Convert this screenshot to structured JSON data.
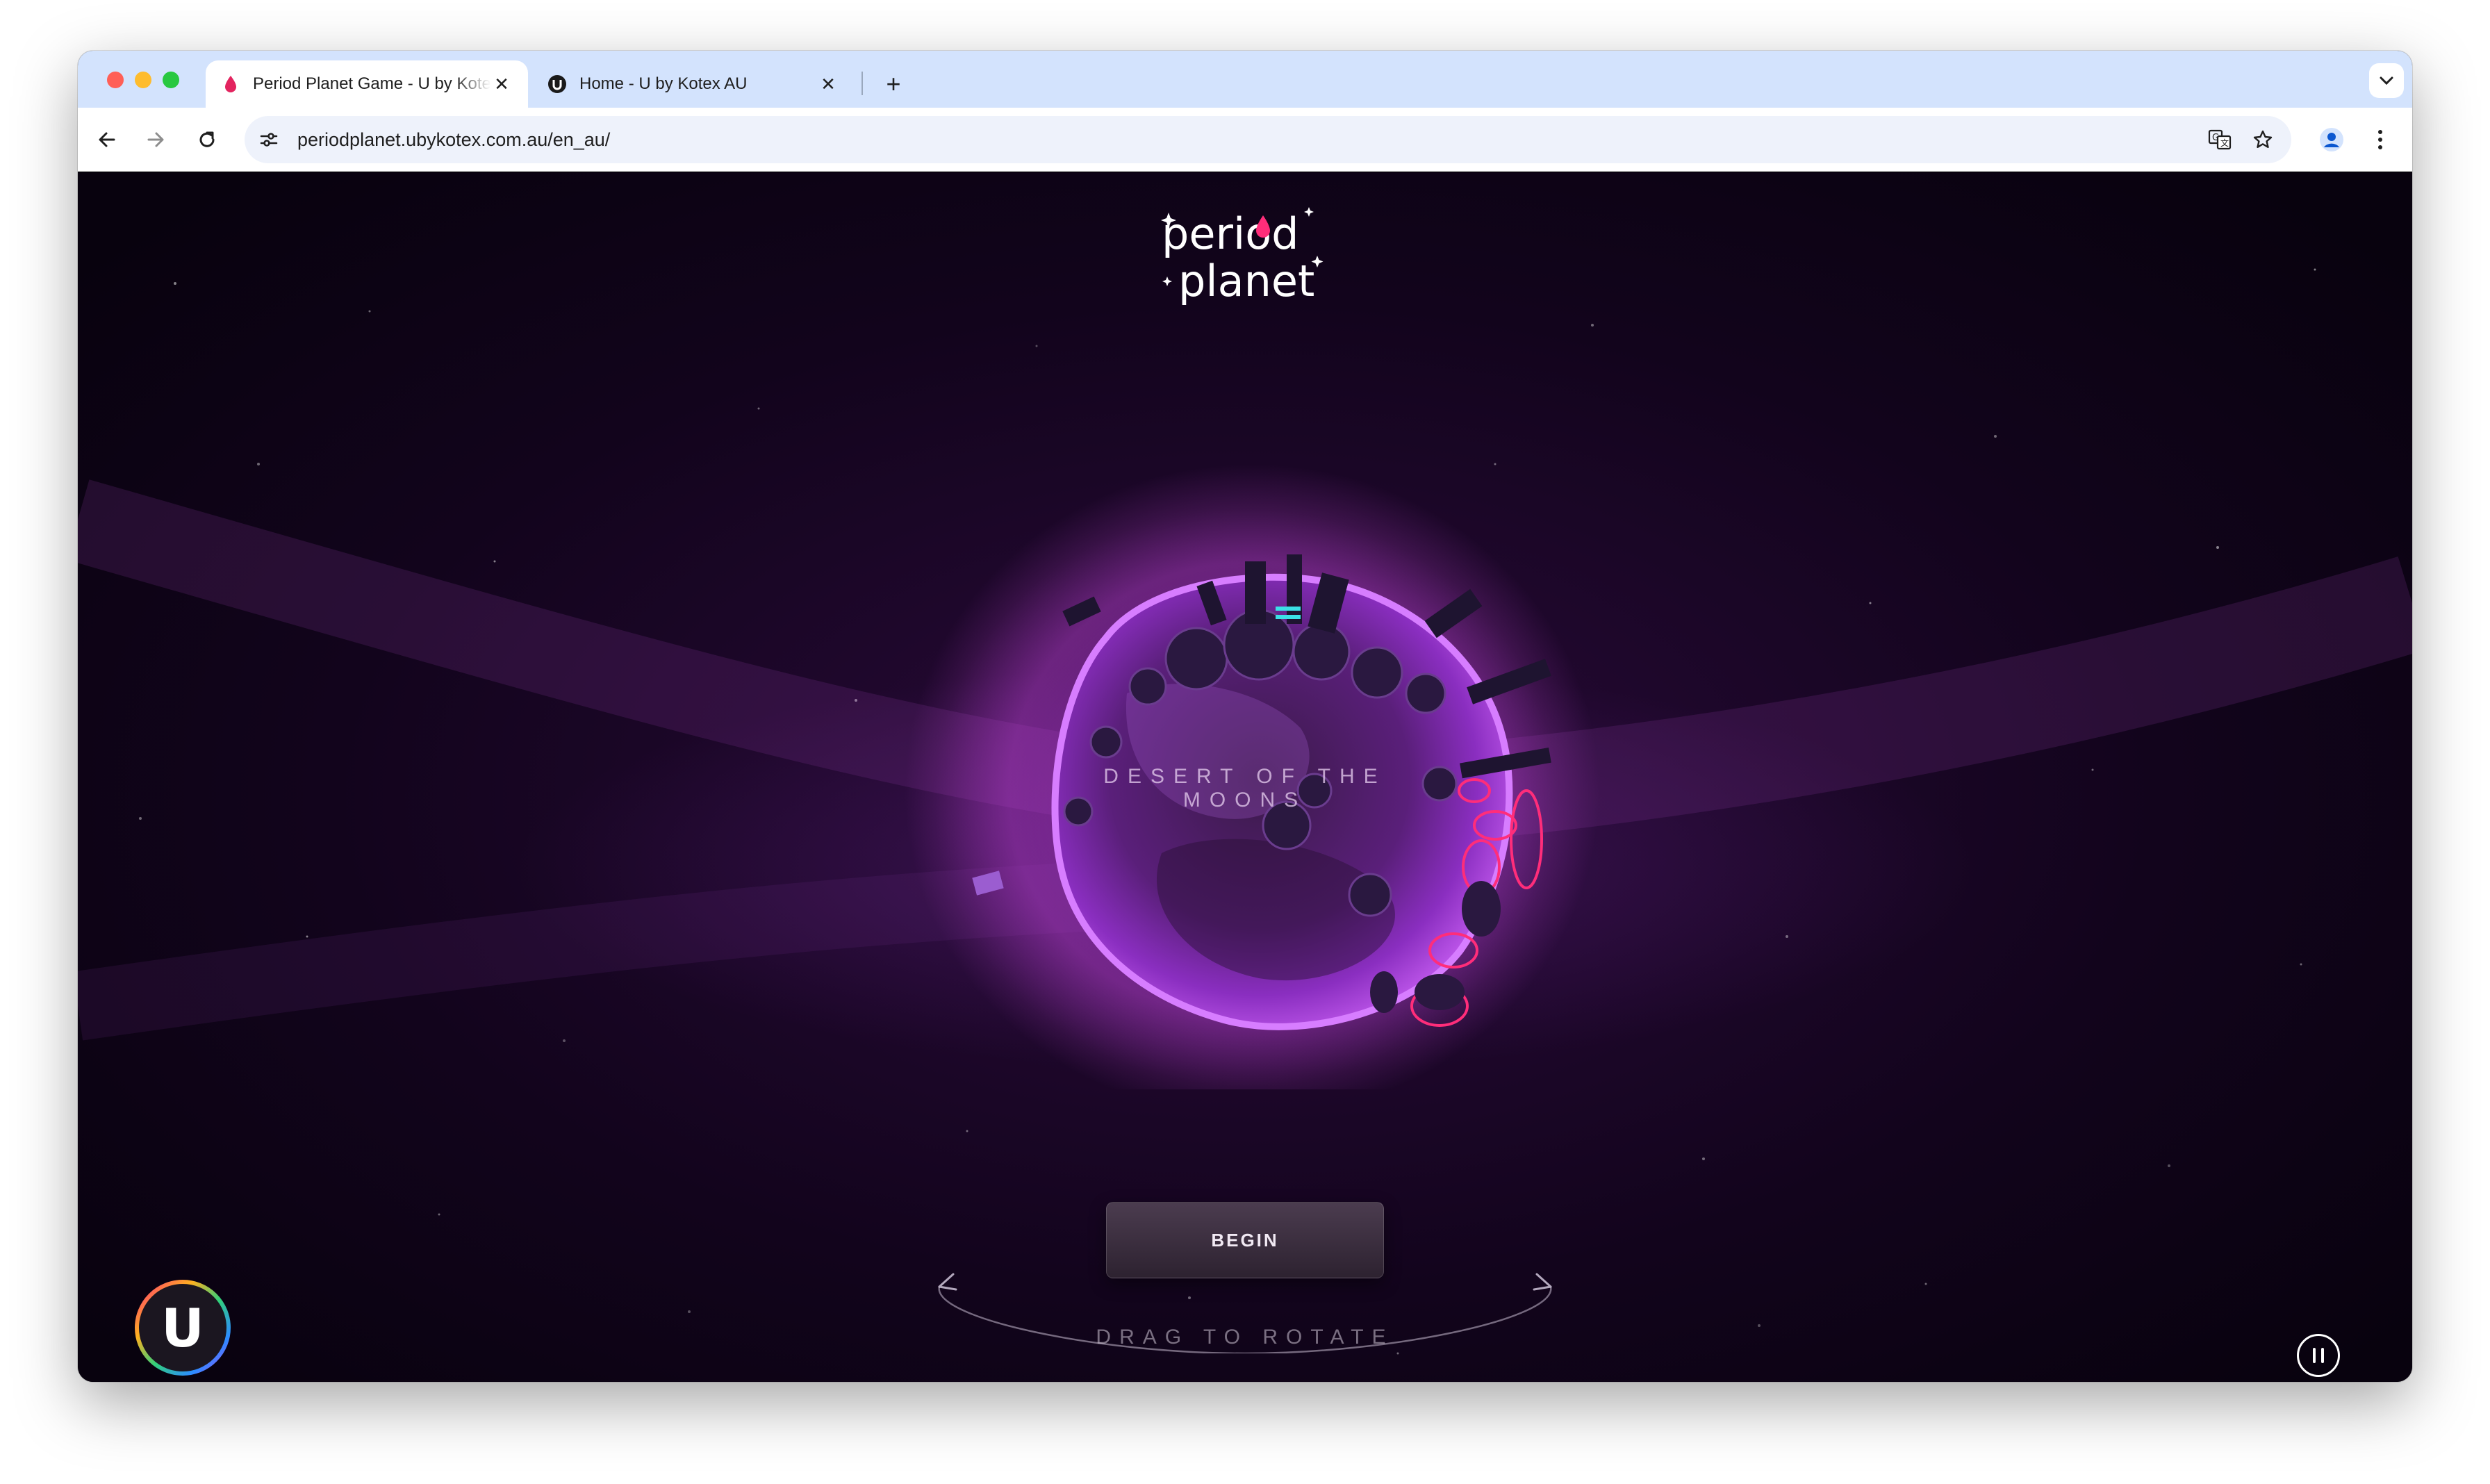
{
  "browser": {
    "tabs": [
      {
        "title": "Period Planet Game - U by Kotex",
        "active": true,
        "favicon": "droplet-icon"
      },
      {
        "title": "Home - U by Kotex AU",
        "active": false,
        "favicon": "u-logo-icon"
      }
    ],
    "new_tab_symbol": "+",
    "close_symbol": "✕",
    "url": "periodplanet.ubykotex.com.au/en_au/"
  },
  "page": {
    "logo": {
      "line1": "period",
      "line2": "planet"
    },
    "planet_label": "DESERT OF THE MOONS",
    "begin_label": "BEGIN",
    "drag_hint": "DRAG TO ROTATE",
    "brand_badge_letter": "U",
    "audio_control": "pause-icon"
  },
  "colors": {
    "tabstrip": "#d3e3fd",
    "background_deep": "#12041c",
    "planet_glow": "#c83cdc",
    "accent_pink": "#ff2d7a"
  }
}
